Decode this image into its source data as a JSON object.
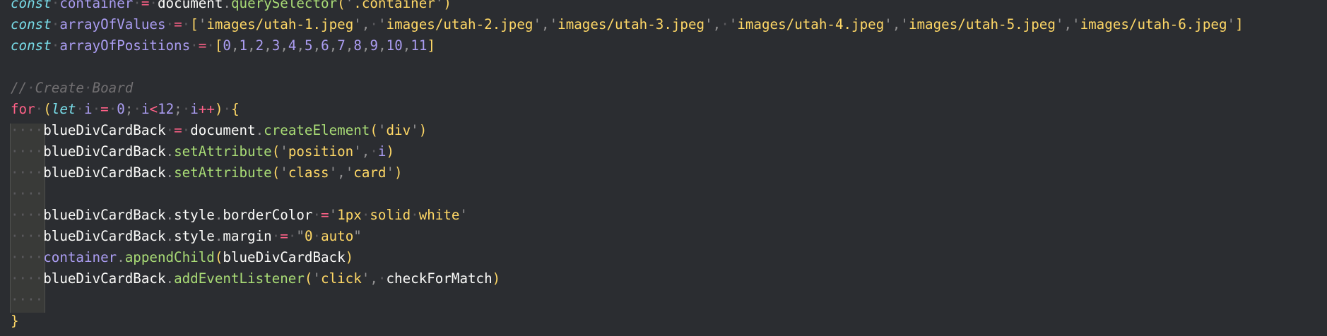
{
  "editor": {
    "theme_colors": {
      "background": "#2b2d31",
      "keyword": "#ff6188",
      "storage": "#78dce8",
      "function": "#a9dc76",
      "string": "#ffd866",
      "number": "#ab9df2",
      "comment": "#727072",
      "text": "#fcfcfa"
    },
    "lines": [
      "const container = document.querySelector('.container')",
      "const arrayOfValues = ['images/utah-1.jpeg', 'images/utah-2.jpeg','images/utah-3.jpeg', 'images/utah-4.jpeg','images/utah-5.jpeg','images/utah-6.jpeg']",
      "const arrayOfPositions = [0,1,2,3,4,5,6,7,8,9,10,11]",
      "",
      "// Create Board",
      "for (let i = 0; i<12; i++) {",
      "    blueDivCardBack = document.createElement('div')",
      "    blueDivCardBack.setAttribute('position', i)",
      "    blueDivCardBack.setAttribute('class','card')",
      "    ",
      "    blueDivCardBack.style.borderColor ='1px solid white'",
      "    blueDivCardBack.style.margin = \"0 auto\"",
      "    container.appendChild(blueDivCardBack)",
      "    blueDivCardBack.addEventListener('click', checkForMatch)",
      "    ",
      "}"
    ]
  }
}
